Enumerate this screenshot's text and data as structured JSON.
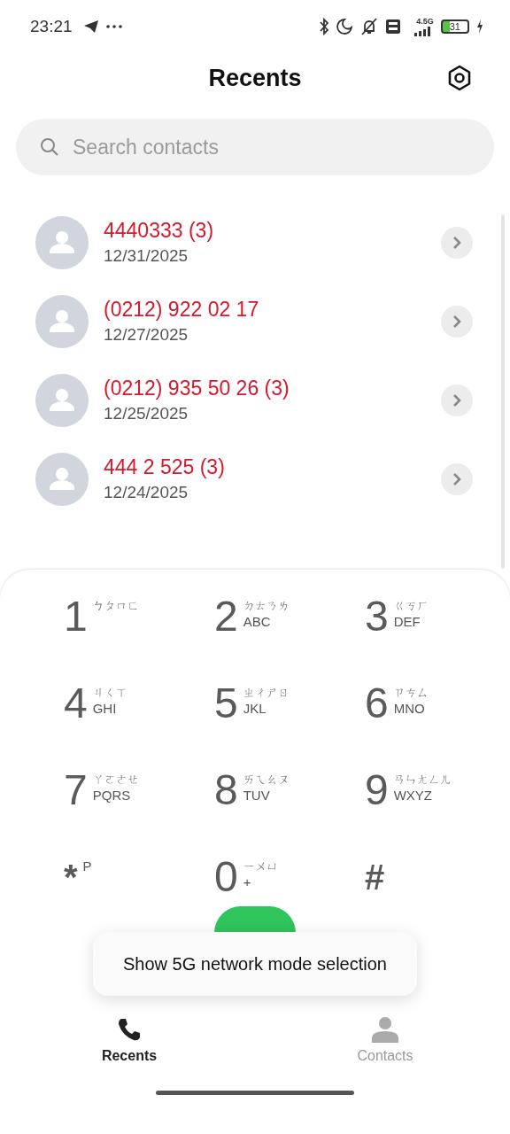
{
  "status_bar": {
    "time": "23:21",
    "network": "4.5G",
    "battery": "31"
  },
  "title": "Recents",
  "search": {
    "placeholder": "Search contacts"
  },
  "calls": [
    {
      "number": "4440333 (3)",
      "date": "12/31/2025",
      "missed": true
    },
    {
      "number": "(0212) 922 02 17",
      "date": "12/27/2025",
      "missed": true
    },
    {
      "number": "(0212) 935 50 26 (3)",
      "date": "12/25/2025",
      "missed": true
    },
    {
      "number": "444 2 525 (3)",
      "date": "12/24/2025",
      "missed": true
    }
  ],
  "keypad": [
    {
      "digit": "1",
      "zhuyin": "ㄅㄆㄇㄈ"
    },
    {
      "digit": "2",
      "zhuyin": "ㄉㄊㄋㄌ",
      "letters": "ABC"
    },
    {
      "digit": "3",
      "zhuyin": "ㄍㄎㄏ",
      "letters": "DEF"
    },
    {
      "digit": "4",
      "zhuyin": "ㄐㄑㄒ",
      "letters": "GHI"
    },
    {
      "digit": "5",
      "zhuyin": "ㄓㄔㄕㄖ",
      "letters": "JKL"
    },
    {
      "digit": "6",
      "zhuyin": "ㄗㄘㄙ",
      "letters": "MNO"
    },
    {
      "digit": "7",
      "zhuyin": "ㄚㄛㄜㄝ",
      "letters": "PQRS"
    },
    {
      "digit": "8",
      "zhuyin": "ㄞㄟㄠㄡ",
      "letters": "TUV"
    },
    {
      "digit": "9",
      "zhuyin": "ㄢㄣㄤㄥㄦ",
      "letters": "WXYZ"
    },
    {
      "digit": "*",
      "letters": "P"
    },
    {
      "digit": "0",
      "zhuyin": "ㄧㄨㄩ",
      "letters": "+"
    },
    {
      "digit": "#"
    }
  ],
  "toast": "Show 5G network mode selection",
  "tabs": [
    {
      "label": "Recents",
      "selected": true,
      "kind": "phone"
    },
    {
      "label": "Contacts",
      "selected": false,
      "kind": "person"
    }
  ]
}
